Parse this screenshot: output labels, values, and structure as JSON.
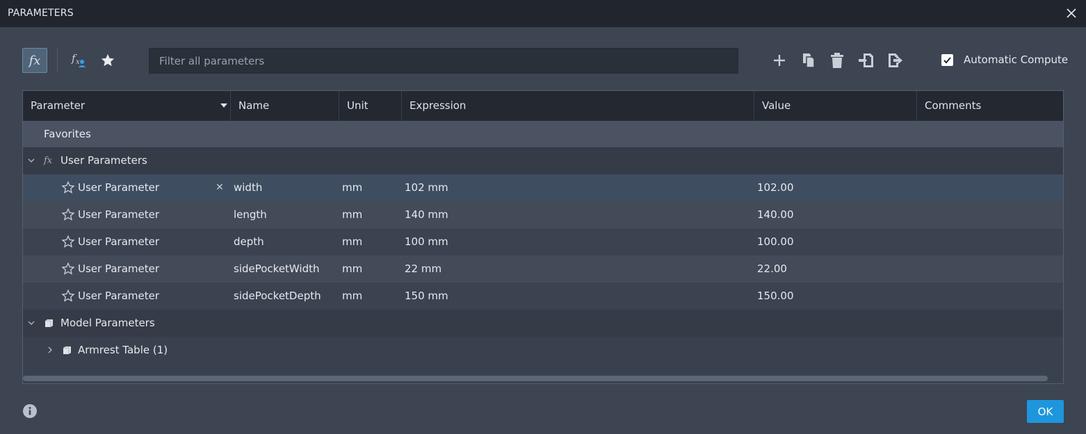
{
  "window": {
    "title": "PARAMETERS"
  },
  "toolbar": {
    "fx_label": "fx",
    "filter_placeholder": "Filter all parameters",
    "automatic_compute_label": "Automatic Compute",
    "automatic_compute_checked": true
  },
  "table": {
    "columns": [
      "Parameter",
      "Name",
      "Unit",
      "Expression",
      "Value",
      "Comments"
    ],
    "favorites_label": "Favorites",
    "user_group_label": "User Parameters",
    "user_rows": [
      {
        "parameter": "User Parameter",
        "name": "width",
        "unit": "mm",
        "expression": "102 mm",
        "value": "102.00",
        "comments": ""
      },
      {
        "parameter": "User Parameter",
        "name": "length",
        "unit": "mm",
        "expression": "140 mm",
        "value": "140.00",
        "comments": ""
      },
      {
        "parameter": "User Parameter",
        "name": "depth",
        "unit": "mm",
        "expression": "100 mm",
        "value": "100.00",
        "comments": ""
      },
      {
        "parameter": "User Parameter",
        "name": "sidePocketWidth",
        "unit": "mm",
        "expression": "22 mm",
        "value": "22.00",
        "comments": ""
      },
      {
        "parameter": "User Parameter",
        "name": "sidePocketDepth",
        "unit": "mm",
        "expression": "150 mm",
        "value": "150.00",
        "comments": ""
      }
    ],
    "model_group_label": "Model Parameters",
    "model_items": [
      {
        "label": "Armrest Table (1)"
      }
    ]
  },
  "footer": {
    "ok_label": "OK"
  },
  "icons": {
    "close": "close-icon",
    "fx_user": "fx-user-icon",
    "star": "star-icon",
    "add": "plus-icon",
    "copy": "copy-icon",
    "delete": "trash-icon",
    "import": "import-icon",
    "export": "export-icon",
    "info": "info-icon"
  },
  "colors": {
    "accent": "#1e96dd",
    "title_bar": "#20252e",
    "background": "#3d4452",
    "header": "#232831"
  }
}
